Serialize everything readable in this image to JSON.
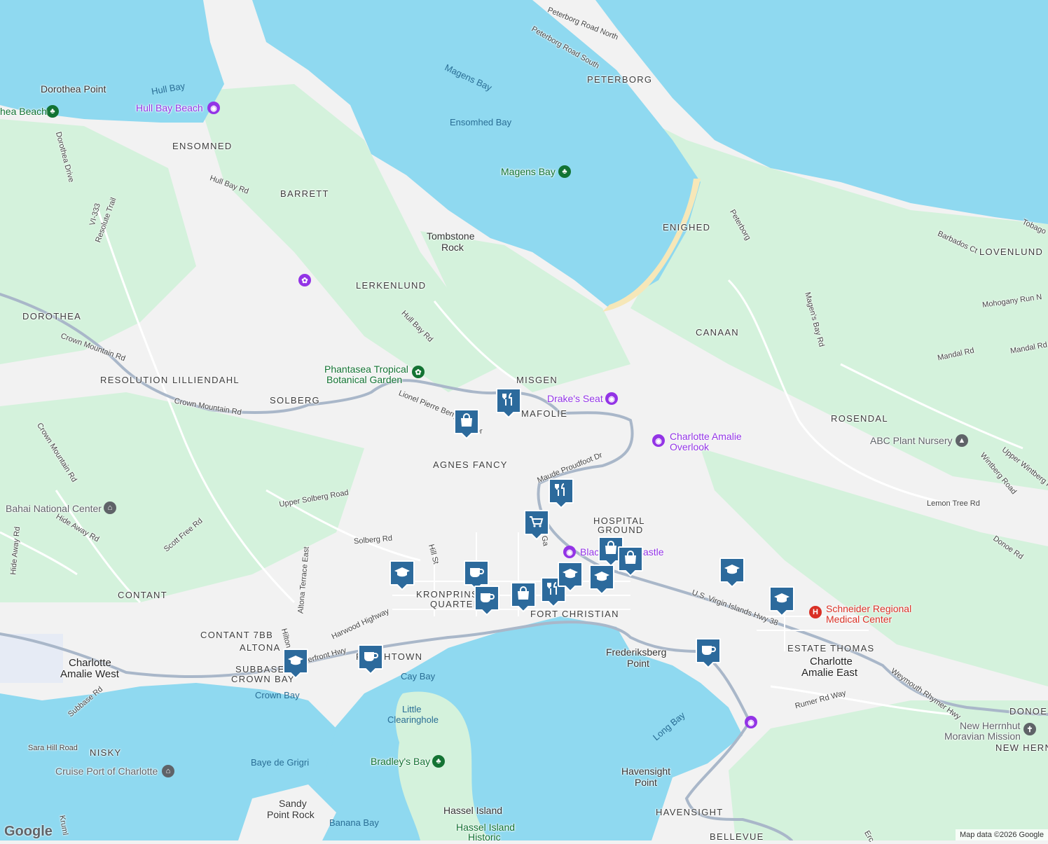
{
  "colors": {
    "water": "#8fd9f0",
    "land": "#f2f2f2",
    "green": "#d4f2dc",
    "road": "#a9b7c9",
    "beach": "#f6e7b8",
    "pin_fill": "#2c6a9c",
    "park_text": "#137333",
    "attraction_text": "#9334e6",
    "hospital_text": "#d93025"
  },
  "neighborhoods": [
    "ENSOMNED",
    "BARRETT",
    "PETERBORG",
    "LERKENLUND",
    "ENIGHED",
    "DOROTHEA",
    "CANAAN",
    "LOVENLUND",
    "RESOLUTION",
    "LILLIENDAHL",
    "MISGEN",
    "SOLBERG",
    "MAFOLIE",
    "ROSENDAL",
    "AGNES FANCY",
    "HOSPITAL",
    "GROUND",
    "CONTANT",
    "CONTANT 7BB",
    "ALTONA",
    "SUBBASE",
    "CROWN BAY",
    "NISKY",
    "FORT CHRISTIAN",
    "ESTATE THOMAS",
    "DONOE",
    "HAVENSIGHT",
    "BELLEVUE",
    "KRONPRINS",
    "QUARTER"
  ],
  "cities": [
    "Charlotte",
    "Amalie West",
    "Charlotte",
    "Amalie East"
  ],
  "places": [
    "Dorothea Point",
    "Tombstone",
    "Rock",
    "Frederiksberg",
    "Point",
    "Havensight",
    "Point",
    "Sandy",
    "Point Rock",
    "Hassel Island",
    "NEW HERN"
  ],
  "water_labels": [
    "Hull Bay",
    "Magens Bay",
    "Ensomhed Bay",
    "Cay Bay",
    "Long Bay",
    "Baye de Grigri",
    "Banana Bay",
    "Crown Bay",
    "Bradley's Bay",
    "Little",
    "Clearinghole"
  ],
  "roads": [
    "Peterborg Road North",
    "Peterborg Road South",
    "Dorothea Drive",
    "Hull Bay Rd",
    "Resolute Trail",
    "VI-333",
    "Hull Bay Rd",
    "Crown Mountain Rd",
    "Crown Mountain Rd",
    "Crown Mountain Rd",
    "Lionel Pierre Berry",
    "Dr",
    "Mandal Rd",
    "Magen's Bay Rd",
    "Mandal Rd",
    "Mohogany Run N",
    "Barbados Ct",
    "Tobago",
    "Peterborg",
    "Upper Solberg Road",
    "Solberg Rd",
    "Hill St",
    "Hide Away Rd",
    "Hide Away Rd",
    "Scott Free Rd",
    "Altona Terrace East",
    "Harwood Highway",
    "Hilton",
    "Waterfront Hwy",
    "Subbase Rd",
    "Sara Hill Road",
    "Maude Proudfoot Dr",
    "Lemon Tree Rd",
    "Wintberg Road",
    "Upper Wintberg R",
    "Donoe Rd",
    "U.S. Virgin Islands Hwy 38",
    "Weymouth Rhymer Hwy",
    "Rumer Rd Way",
    "Kruml",
    "Erc",
    "Ga"
  ],
  "pois": {
    "hull_bay_beach": "Hull Bay Beach",
    "dorothea_beach": "hea Beach",
    "magens_bay": "Magens Bay",
    "phantasea": "Phantasea Tropical",
    "phantasea2": "Botanical Garden",
    "drakes_seat": "Drake's Seat",
    "overlook1": "Charlotte Amalie",
    "overlook2": "Overlook",
    "bahai": "Bahai National Center",
    "abc": "ABC Plant Nursery",
    "blackbeard": "Blac",
    "blackbeard2": "astle",
    "schneider1": "Schneider Regional",
    "schneider2": "Medical Center",
    "cruise": "Cruise Port of Charlotte",
    "bradleys": "Bradley's Bay",
    "moravian1": "New Herrnhut",
    "moravian2": "Moravian Mission",
    "hassel_hist": "Hassel Island",
    "hassel_hist2": "Historic",
    "frenchtown_a": "F",
    "frenchtown_b": "HTOWN"
  },
  "pin_icons": [
    "fork-knife",
    "shopping-bag",
    "fork-knife",
    "shopping-cart",
    "shopping-bag",
    "shopping-bag",
    "school",
    "school",
    "school",
    "school",
    "coffee",
    "coffee",
    "coffee",
    "coffee",
    "shopping-bag",
    "fork-knife",
    "school",
    "school"
  ],
  "branding": {
    "logo": "Google",
    "attribution": "Map data ©2026 Google"
  }
}
